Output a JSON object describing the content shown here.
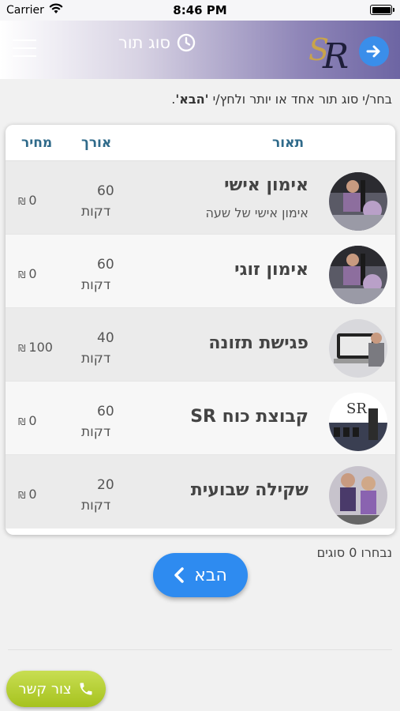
{
  "statusbar": {
    "carrier": "Carrier",
    "time": "8:46 PM",
    "battery": 1.0
  },
  "navbar": {
    "title": "סוג תור",
    "icons": [
      "menu-icon",
      "clock-icon",
      "sr-logo",
      "arrow-right-icon"
    ]
  },
  "instruction": {
    "text_before": "בחר/י סוג תור אחד או יותר ולחץ/י ",
    "bold_text": "'הבא'",
    "text_after": "."
  },
  "table": {
    "headers": {
      "description": "תאור",
      "length": "אורך",
      "price": "מחיר"
    },
    "rows": [
      {
        "name": "אימון אישי",
        "subtitle": "אימון אישי של שעה",
        "duration": "60",
        "unit": "דקות",
        "price": "0",
        "currency": "₪",
        "image": "gym-training-photo"
      },
      {
        "name": "אימון זוגי",
        "subtitle": "",
        "duration": "60",
        "unit": "דקות",
        "price": "0",
        "currency": "₪",
        "image": "gym-training-photo"
      },
      {
        "name": "פגישת תזונה",
        "subtitle": "",
        "duration": "40",
        "unit": "דקות",
        "price": "100",
        "currency": "₪",
        "image": "nutrition-laptop-photo"
      },
      {
        "name": "קבוצת כוח SR",
        "subtitle": "",
        "duration": "60",
        "unit": "דקות",
        "price": "0",
        "currency": "₪",
        "image": "dumbbells-photo"
      },
      {
        "name": "שקילה שבועית",
        "subtitle": "",
        "duration": "20",
        "unit": "דקות",
        "price": "0",
        "currency": "₪",
        "image": "women-fitness-photo"
      }
    ]
  },
  "selected_count_text": "נבחרו 0 סוגים",
  "next_button": {
    "label": "הבא",
    "icon": "chevron-left-icon",
    "color": "#2e8bf0"
  },
  "contact_button": {
    "label": "צור קשר",
    "icon": "phone-icon",
    "color": "#b4cf30"
  }
}
